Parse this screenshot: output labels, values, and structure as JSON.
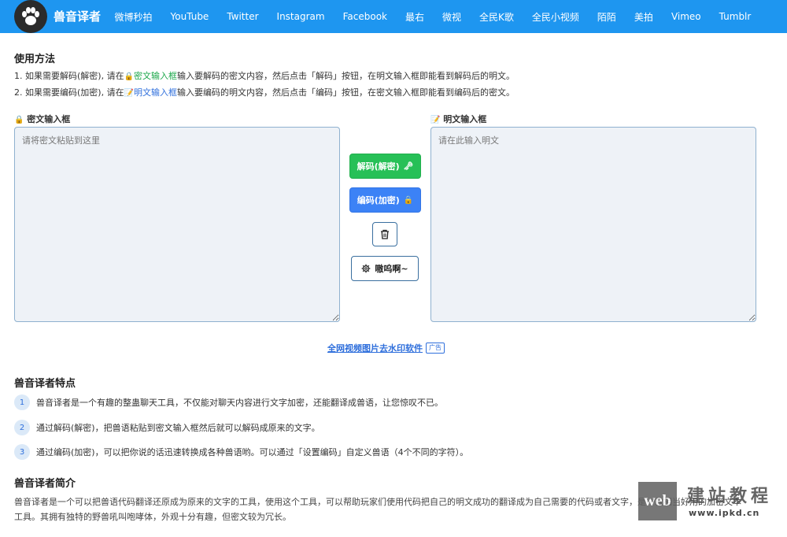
{
  "nav": {
    "brand": "兽音译者",
    "links": [
      "微博秒拍",
      "YouTube",
      "Twitter",
      "Instagram",
      "Facebook",
      "最右",
      "微视",
      "全民K歌",
      "全民小视频",
      "陌陌",
      "美拍",
      "Vimeo",
      "Tumblr"
    ]
  },
  "usage": {
    "title": "使用方法",
    "line1_pre": "1. 如果需要解码(解密), 请在",
    "line1_hl": "密文输入框",
    "line1_post": "输入要解码的密文内容，然后点击「解码」按钮，在明文输入框即能看到解码后的明文。",
    "line2_pre": "2. 如果需要编码(加密), 请在",
    "line2_hl": "明文输入框",
    "line2_post": "输入要编码的明文内容，然后点击「编码」按钮，在密文输入框即能看到编码后的密文。"
  },
  "cipher": {
    "label": "密文输入框",
    "placeholder": "请将密文粘贴到这里",
    "icon": "lock-icon"
  },
  "plain": {
    "label": "明文输入框",
    "placeholder": "请在此输入明文",
    "icon": "memo-icon"
  },
  "buttons": {
    "decode": "解码(解密)",
    "encode": "编码(加密)",
    "settings": "嗷呜啊~"
  },
  "ad": {
    "link": "全网视频图片去水印软件",
    "badge": "广告"
  },
  "features": {
    "title": "兽音译者特点",
    "items": [
      "兽音译者是一个有趣的整蛊聊天工具，不仅能对聊天内容进行文字加密，还能翻译成兽语，让您惊叹不已。",
      "通过解码(解密)，把兽语粘贴到密文输入框然后就可以解码成原来的文字。",
      "通过编码(加密)，可以把你说的话迅速转换成各种兽语哟。可以通过「设置编码」自定义兽语（4个不同的字符）。"
    ]
  },
  "intro": {
    "title": "兽音译者简介",
    "text": "兽音译者是一个可以把兽语代码翻译还原成为原来的文字的工具，使用这个工具，可以帮助玩家们使用代码把自己的明文成功的翻译成为自己需要的代码或者文字，是一款相当好用的加密文本工具。其拥有独特的野兽吼叫咆哮体，外观十分有趣，但密文较为冗长。"
  },
  "watermark": {
    "box": "web",
    "cn": "建站教程",
    "url": "www.ipkd.cn"
  },
  "colors": {
    "nav": "#1e96f0",
    "green": "#27c057",
    "blue": "#3c82f6"
  }
}
